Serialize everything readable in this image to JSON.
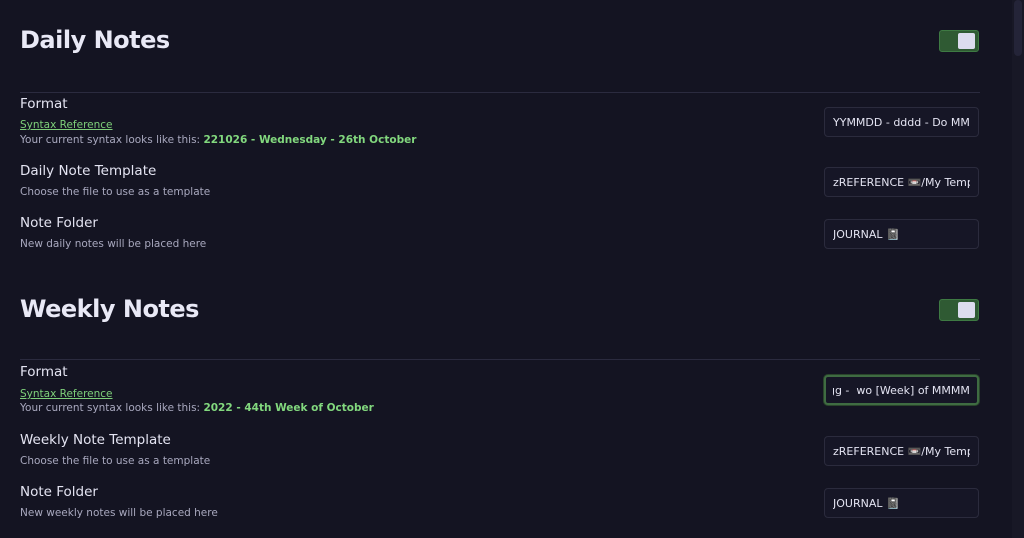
{
  "daily": {
    "title": "Daily Notes",
    "enabled": true,
    "format": {
      "label": "Format",
      "link": "Syntax Reference",
      "syntax_prefix": "Your current syntax looks like this: ",
      "syntax_preview": "221026 - Wednesday - 26th October",
      "value": "YYMMDD - dddd - Do MMMM"
    },
    "template": {
      "label": "Daily Note Template",
      "desc": "Choose the file to use as a template",
      "value": "zREFERENCE 📼/My Templates"
    },
    "folder": {
      "label": "Note Folder",
      "desc": "New daily notes will be placed here",
      "value": "JOURNAL 📓"
    }
  },
  "weekly": {
    "title": "Weekly Notes",
    "enabled": true,
    "format": {
      "label": "Format",
      "link": "Syntax Reference",
      "syntax_prefix": "Your current syntax looks like this: ",
      "syntax_preview": "2022 - 44th Week of October",
      "value": "gggg -  wo [Week] of MMMM"
    },
    "template": {
      "label": "Weekly Note Template",
      "desc": "Choose the file to use as a template",
      "value": "zREFERENCE 📼/My Templates"
    },
    "folder": {
      "label": "Note Folder",
      "desc": "New weekly notes will be placed here",
      "value": "JOURNAL 📓"
    }
  }
}
